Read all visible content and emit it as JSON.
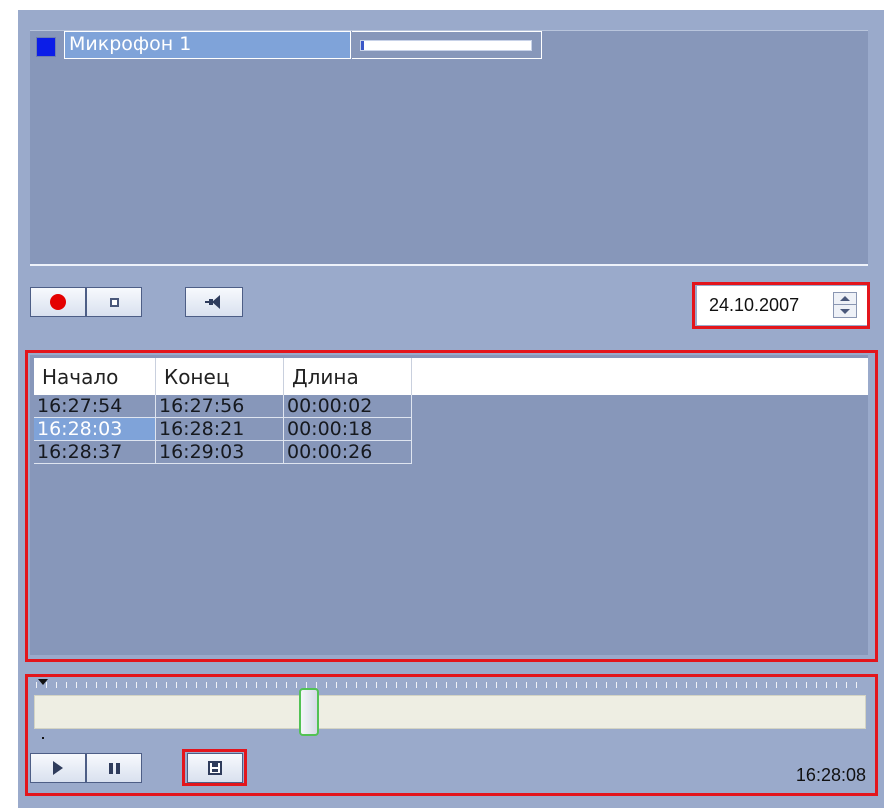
{
  "microphones": [
    {
      "name": "Микрофон 1",
      "color": "#0b1de8",
      "level": 0.02
    }
  ],
  "controls": {
    "record_icon": "record-icon",
    "stop_icon": "stop-icon",
    "speaker_icon": "speaker-icon"
  },
  "date": {
    "value": "24.10.2007"
  },
  "records": {
    "columns": [
      "Начало",
      "Конец",
      "Длина"
    ],
    "rows": [
      {
        "start": "16:27:54",
        "end": "16:27:56",
        "length": "00:00:02",
        "selected": false
      },
      {
        "start": "16:28:03",
        "end": "16:28:21",
        "length": "00:00:18",
        "selected": true
      },
      {
        "start": "16:28:37",
        "end": "16:29:03",
        "length": "00:00:26",
        "selected": false
      }
    ]
  },
  "timeline": {
    "position": 0.33,
    "time": "16:28:08",
    "play_icon": "play-icon",
    "pause_icon": "pause-icon",
    "save_icon": "save-icon"
  },
  "colors": {
    "highlight": "#e3151c",
    "selection": "#7fa3d9",
    "panel": "#8797ba"
  }
}
